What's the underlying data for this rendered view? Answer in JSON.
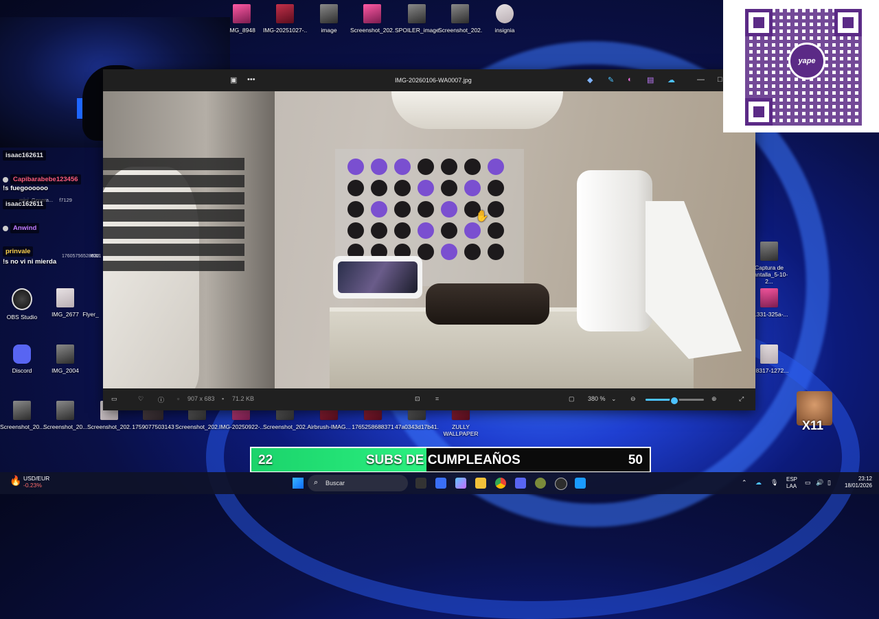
{
  "desktop_top_icons": [
    {
      "label": "IMG_8948"
    },
    {
      "label": "IMG-20251027-..."
    },
    {
      "label": "image"
    },
    {
      "label": "Screenshot_202..."
    },
    {
      "label": "SPOILER_image"
    },
    {
      "label": "Screenshot_202..."
    },
    {
      "label": "insignia"
    }
  ],
  "desktop_left_icons": [
    {
      "label": "OBS Studio"
    },
    {
      "label": "IMG_2677"
    },
    {
      "label": "Flyer_"
    },
    {
      "label": "Discord"
    },
    {
      "label": "IMG_2004"
    }
  ],
  "desktop_right_icons": [
    {
      "label": "Captura de pantalla_5-10-2..."
    },
    {
      "label": "91331-325a-..."
    },
    {
      "label": "bc8317-1272..."
    }
  ],
  "desktop_bottom_icons": [
    {
      "label": "Screenshot_20..."
    },
    {
      "label": "Screenshot_20..."
    },
    {
      "label": "Screenshot_202..."
    },
    {
      "label": "1759077503143"
    },
    {
      "label": "Screenshot_202..."
    },
    {
      "label": "IMG-20250922-..."
    },
    {
      "label": "Screenshot_202..."
    },
    {
      "label": "Airbrush-IMAG..."
    },
    {
      "label": "1765258688371"
    },
    {
      "label": "47a0343d17b41..."
    },
    {
      "label": "ZULLY WALLPAPER"
    }
  ],
  "chat": {
    "messages": [
      {
        "user": "isaac162611",
        "user_color": "#e6e6e6",
        "text": ""
      },
      {
        "user": "Capibarabebe123456",
        "user_color": "#ff5c7a",
        "text": "!s fuegoooooo"
      },
      {
        "user": "isaac162611",
        "user_color": "#e6e6e6",
        "text": ""
      },
      {
        "user": "Anwind",
        "user_color": "#c27cff",
        "text": ""
      },
      {
        "user": "prinvale",
        "user_color": "#ffd34d",
        "text": "!s no vi ni mierda"
      }
    ],
    "behind_labels": [
      "mini_Genera...",
      "f7129",
      "17605756528632",
      "ff0b1"
    ]
  },
  "viewer": {
    "title": "IMG-20260106-WA0007.jpg",
    "more_label": "•••",
    "minimize_label": "—",
    "dimensions": "907 x 683",
    "file_size": "71.2 KB",
    "zoom_percent": "380 %",
    "zoom_level": 0.47
  },
  "qr": {
    "brand": "yape"
  },
  "sub_goal": {
    "current": "22",
    "label": "SUBS DE CUMPLEAÑOS",
    "target": "50",
    "progress": 0.44
  },
  "meme": {
    "overlay": "X11"
  },
  "taskbar": {
    "ticker_name": "USD/EUR",
    "ticker_change": "-0.23%",
    "search_label": "Buscar",
    "lang_top": "ESP",
    "lang_bottom": "LAA",
    "time": "23:12",
    "date": "18/01/2026"
  },
  "colors": {
    "accent": "#4cc2ff",
    "qr_purple": "#5b2a86",
    "goal_green": "#2bef7f"
  }
}
